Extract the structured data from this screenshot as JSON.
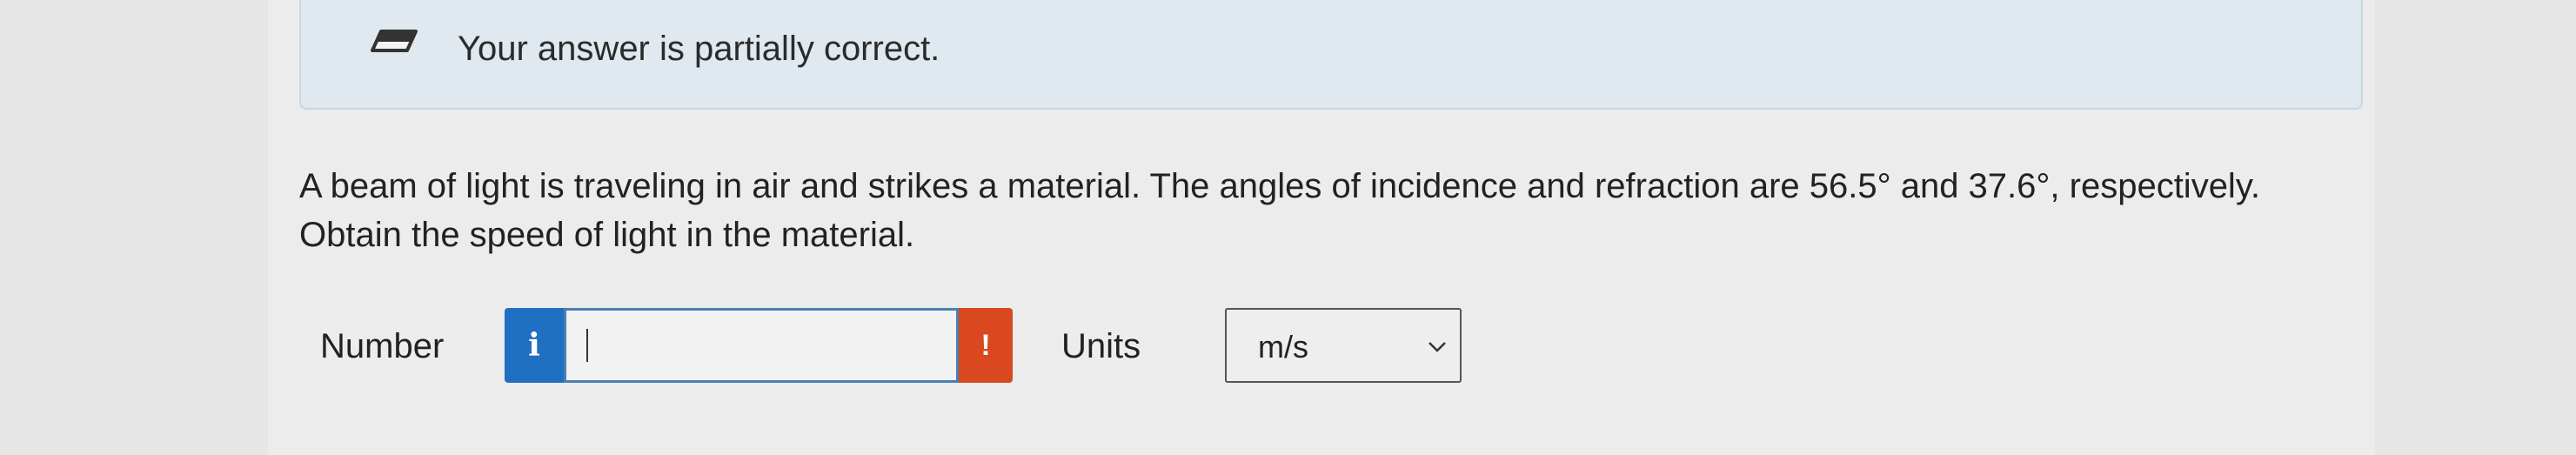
{
  "feedback": {
    "icon": "pencil-icon",
    "message": "Your answer is partially correct."
  },
  "question": {
    "text": "A beam of light is traveling in air and strikes a material. The angles of incidence and refraction are 56.5° and 37.6°, respectively. Obtain the speed of light in the material."
  },
  "answer": {
    "number_label": "Number",
    "info_icon": "info-icon",
    "info_glyph": "i",
    "number_value": "",
    "warning_icon": "warning-icon",
    "warning_glyph": "!",
    "units_label": "Units",
    "units_selected": "m/s"
  },
  "colors": {
    "info_button": "#1f6fc2",
    "warning_button": "#d9481f",
    "banner_bg": "#dfe9ef"
  }
}
